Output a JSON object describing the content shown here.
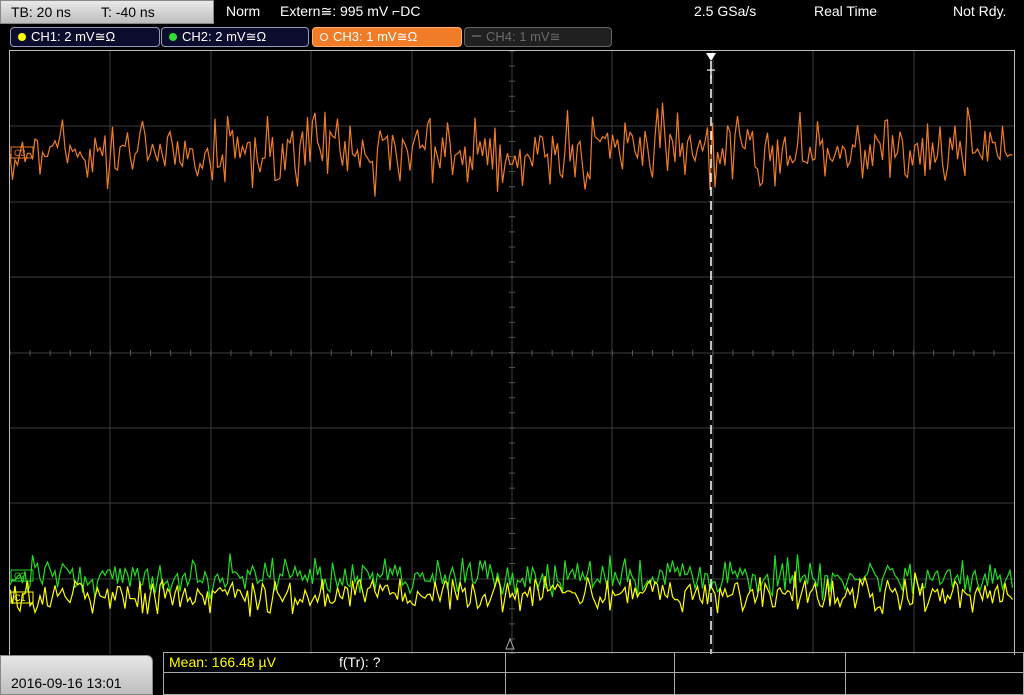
{
  "header": {
    "timebase": "TB: 20 ns",
    "trigger_time": "T: -40 ns",
    "mode": "Norm",
    "trigger_source": "Extern≅: 995 mV ⌐DC",
    "sample_rate": "2.5 GSa/s",
    "acquisition": "Real Time",
    "status": "Not Rdy."
  },
  "channels": [
    {
      "label": "CH1: 2 mV≅Ω",
      "color": "#ffff00",
      "state": "inactive"
    },
    {
      "label": "CH2: 2 mV≅Ω",
      "color": "#33dd33",
      "state": "inactive"
    },
    {
      "label": "CH3: 1 mV≅Ω",
      "color": "#ff8833",
      "state": "active"
    },
    {
      "label": "CH4: 1 mV≅",
      "color": "#666666",
      "state": "disabled"
    }
  ],
  "markers": {
    "trigger": "T",
    "ch3": "C3",
    "ch2": "C2",
    "ch1": "C1"
  },
  "footer": {
    "datetime": "2016-09-16 13:01",
    "measurement_1": "Mean: 166.48 µV",
    "measurement_2": "f(Tr): ?"
  },
  "colors": {
    "ch1": "#ffff00",
    "ch2": "#22dd22",
    "ch3": "#f07c28",
    "grid": "#3d3d3d",
    "frame": "#bdbdbd"
  }
}
